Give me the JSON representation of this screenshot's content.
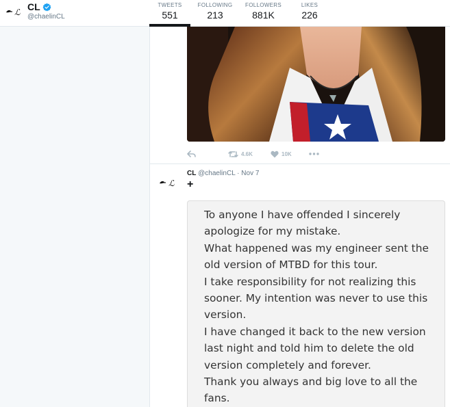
{
  "profile": {
    "name": "CL",
    "handle": "@chaelinCL",
    "verified": true
  },
  "nav": {
    "stats": [
      {
        "label": "TWEETS",
        "value": "551",
        "active": true
      },
      {
        "label": "FOLLOWING",
        "value": "213",
        "active": false
      },
      {
        "label": "FOLLOWERS",
        "value": "881K",
        "active": false
      },
      {
        "label": "LIKES",
        "value": "226",
        "active": false
      }
    ]
  },
  "tweet1": {
    "photo": {
      "description_icon": "photo"
    },
    "actions": {
      "reply_icon": "reply-icon",
      "retweet_count": "4.6K",
      "like_count": "10K",
      "more_icon": "more-icon"
    }
  },
  "tweet2": {
    "name": "CL",
    "handle": "@chaelinCL",
    "separator": "·",
    "date": "Nov 7",
    "text": "+",
    "note_lines": [
      "To anyone I have offended I sincerely",
      "apologize for my mistake.",
      "What happened was my engineer sent the",
      "old version of MTBD for this tour.",
      "I take responsibility for not realizing this",
      "sooner. My intention was never to use this",
      "version.",
      "I have changed it back to the new version",
      "last night and told him to delete the old",
      "version completely and forever.",
      "Thank you always and big love to all the",
      "fans."
    ]
  },
  "colors": {
    "accent": "#1da1f2",
    "muted": "#aab8c2",
    "text": "#14171a",
    "secondary": "#657786"
  }
}
